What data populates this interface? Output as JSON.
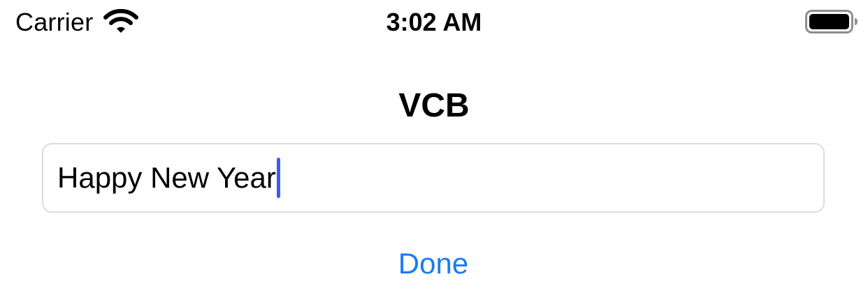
{
  "status_bar": {
    "carrier": "Carrier",
    "time": "3:02 AM",
    "wifi_icon": "wifi-icon",
    "battery_icon": "battery-icon"
  },
  "nav": {
    "title": "VCB"
  },
  "text_field": {
    "value": "Happy New Year",
    "caret_color": "#3d5cf5"
  },
  "done_button": {
    "label": "Done",
    "color": "#1a7cf5"
  }
}
